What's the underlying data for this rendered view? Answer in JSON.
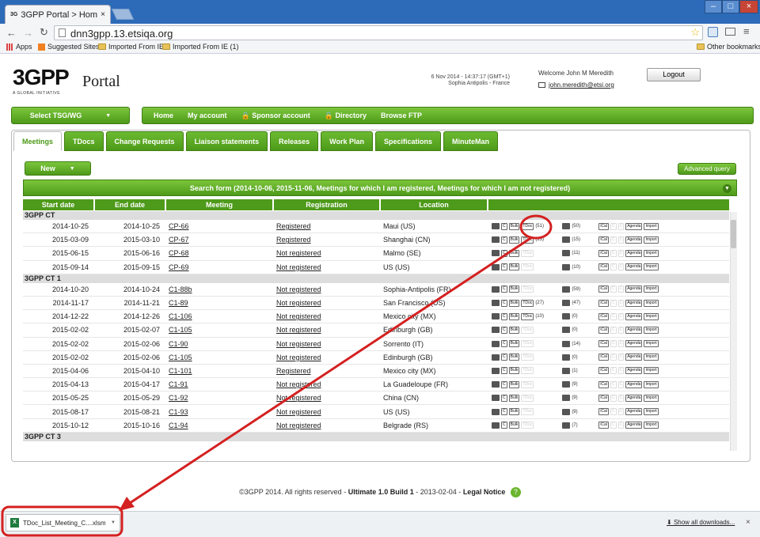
{
  "browser": {
    "tab_title": "3GPP Portal > Home",
    "url": "dnn3gpp.13.etsiqa.org",
    "bookmarks": [
      "Apps",
      "Suggested Sites",
      "Imported From IE",
      "Imported From IE (1)"
    ],
    "other_bookmarks": "Other bookmarks"
  },
  "header": {
    "logo_text": "3GPP",
    "logo_sub": "A GLOBAL INITIATIVE",
    "portal": "Portal",
    "date": "6 Nov 2014 - 14:37:17 (GMT+1)",
    "location": "Sophia Antipolis - France",
    "welcome": "Welcome John M Meredith",
    "email": "john.meredith@etsi.org",
    "logout": "Logout"
  },
  "nav": {
    "select_tsg": "Select TSG/WG",
    "items": [
      "Home",
      "My account",
      "Sponsor account",
      "Directory",
      "Browse FTP"
    ]
  },
  "tabs": [
    "Meetings",
    "TDocs",
    "Change Requests",
    "Liaison statements",
    "Releases",
    "Work Plan",
    "Specifications",
    "MinuteMan"
  ],
  "actions": {
    "new": "New",
    "advanced": "Advanced query",
    "search_form": "Search form (2014-10-06, 2015-11-06, Meetings for which I am registered, Meetings for which I am not registered)"
  },
  "table": {
    "headers": [
      "Start date",
      "End date",
      "Meeting",
      "Registration",
      "Location"
    ],
    "groups": [
      {
        "name": "3GPP CT",
        "rows": [
          {
            "start": "2014-10-25",
            "end": "2014-10-25",
            "meeting": "CP-66",
            "reg": "Registered",
            "loc": "Maui (US)",
            "tdoc": "(51)",
            "cnt": "(50)"
          },
          {
            "start": "2015-03-09",
            "end": "2015-03-10",
            "meeting": "CP-67",
            "reg": "Registered",
            "loc": "Shanghai (CN)",
            "tdoc": "(13)",
            "cnt": "(15)"
          },
          {
            "start": "2015-06-15",
            "end": "2015-06-16",
            "meeting": "CP-68",
            "reg": "Not registered",
            "loc": "Malmo (SE)",
            "tdoc": "",
            "cnt": "(11)"
          },
          {
            "start": "2015-09-14",
            "end": "2015-09-15",
            "meeting": "CP-69",
            "reg": "Not registered",
            "loc": "US (US)",
            "tdoc": "",
            "cnt": "(10)"
          }
        ]
      },
      {
        "name": "3GPP CT 1",
        "rows": [
          {
            "start": "2014-10-20",
            "end": "2014-10-24",
            "meeting": "C1-88b",
            "reg": "Not registered",
            "loc": "Sophia-Antipolis (FR)",
            "tdoc": "",
            "cnt": "(59)"
          },
          {
            "start": "2014-11-17",
            "end": "2014-11-21",
            "meeting": "C1-89",
            "reg": "Not registered",
            "loc": "San Francisco (US)",
            "tdoc": "(27)",
            "cnt": "(47)"
          },
          {
            "start": "2014-12-22",
            "end": "2014-12-26",
            "meeting": "C1-106",
            "reg": "Not registered",
            "loc": "Mexico city (MX)",
            "tdoc": "(10)",
            "cnt": "(0)"
          },
          {
            "start": "2015-02-02",
            "end": "2015-02-07",
            "meeting": "C1-105",
            "reg": "Not registered",
            "loc": "Edinburgh (GB)",
            "tdoc": "",
            "cnt": "(0)"
          },
          {
            "start": "2015-02-02",
            "end": "2015-02-06",
            "meeting": "C1-90",
            "reg": "Not registered",
            "loc": "Sorrento (IT)",
            "tdoc": "",
            "cnt": "(14)"
          },
          {
            "start": "2015-02-02",
            "end": "2015-02-06",
            "meeting": "C1-105",
            "reg": "Not registered",
            "loc": "Edinburgh (GB)",
            "tdoc": "",
            "cnt": "(0)"
          },
          {
            "start": "2015-04-06",
            "end": "2015-04-10",
            "meeting": "C1-101",
            "reg": "Registered",
            "loc": "Mexico city (MX)",
            "tdoc": "",
            "cnt": "(1)"
          },
          {
            "start": "2015-04-13",
            "end": "2015-04-17",
            "meeting": "C1-91",
            "reg": "Not registered",
            "loc": "La Guadeloupe (FR)",
            "tdoc": "",
            "cnt": "(9)"
          },
          {
            "start": "2015-05-25",
            "end": "2015-05-29",
            "meeting": "C1-92",
            "reg": "Not registered",
            "loc": "China (CN)",
            "tdoc": "",
            "cnt": "(9)"
          },
          {
            "start": "2015-08-17",
            "end": "2015-08-21",
            "meeting": "C1-93",
            "reg": "Not registered",
            "loc": "US (US)",
            "tdoc": "",
            "cnt": "(9)"
          },
          {
            "start": "2015-10-12",
            "end": "2015-10-16",
            "meeting": "C1-94",
            "reg": "Not registered",
            "loc": "Belgrade (RS)",
            "tdoc": "",
            "cnt": "(7)"
          }
        ]
      },
      {
        "name": "3GPP CT 3",
        "rows": []
      }
    ],
    "icon_labels": {
      "c": "C",
      "bulk": "Bulk",
      "tdoc": "TDoc",
      "ical": "iCal",
      "agenda": "Agenda",
      "import": "Import"
    }
  },
  "footer": {
    "copyright": "©3GPP 2014. All rights reserved -",
    "version": "Ultimate 1.0 Build 1",
    "date": "- 2013-02-04 -",
    "legal": "Legal Notice",
    "help": "?"
  },
  "download": {
    "file": "TDoc_List_Meeting_C....xlsm",
    "show_all": "Show all downloads..."
  },
  "colors": {
    "green": "#5aa820",
    "annotation": "#d42020"
  }
}
